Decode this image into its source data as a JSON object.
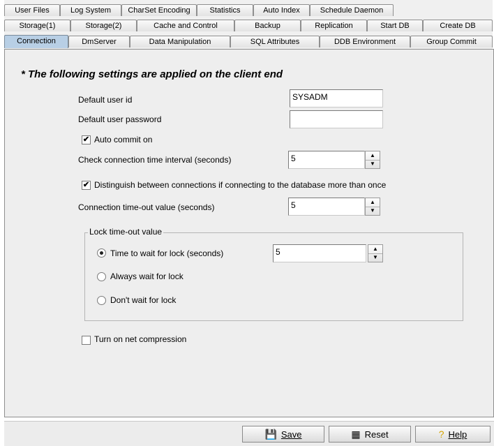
{
  "tabs": {
    "row1": [
      "User Files",
      "Log System",
      "CharSet Encoding",
      "Statistics",
      "Auto Index",
      "Schedule Daemon"
    ],
    "row2": [
      "Storage(1)",
      "Storage(2)",
      "Cache and Control",
      "Backup",
      "Replication",
      "Start DB",
      "Create DB"
    ],
    "row3": [
      "Connection",
      "DmServer",
      "Data Manipulation",
      "SQL Attributes",
      "DDB Environment",
      "Group Commit"
    ],
    "active": "Connection"
  },
  "panel": {
    "heading": "* The following settings are applied on the client end",
    "default_user_id_label": "Default user id",
    "default_user_id_value": "SYSADM",
    "default_user_password_label": "Default user password",
    "default_user_password_value": "",
    "auto_commit_label": "Auto commit on",
    "auto_commit_checked": true,
    "check_interval_label": "Check connection time interval (seconds)",
    "check_interval_value": "5",
    "distinguish_label": "Distinguish between connections if connecting to the database more than once",
    "distinguish_checked": true,
    "timeout_label": "Connection time-out value (seconds)",
    "timeout_value": "5",
    "lock_group_title": "Lock time-out value",
    "lock_option_wait_label": "Time to wait for lock (seconds)",
    "lock_option_wait_value": "5",
    "lock_option_always_label": "Always wait for lock",
    "lock_option_dont_label": "Don't wait for lock",
    "lock_selected": "wait",
    "net_compression_label": "Turn on net compression",
    "net_compression_checked": false
  },
  "buttons": {
    "save": "Save",
    "reset": "Reset",
    "help": "Help"
  },
  "icons": {
    "save": "save-disk-icon",
    "reset": "reset-icon",
    "help": "help-question-icon"
  }
}
